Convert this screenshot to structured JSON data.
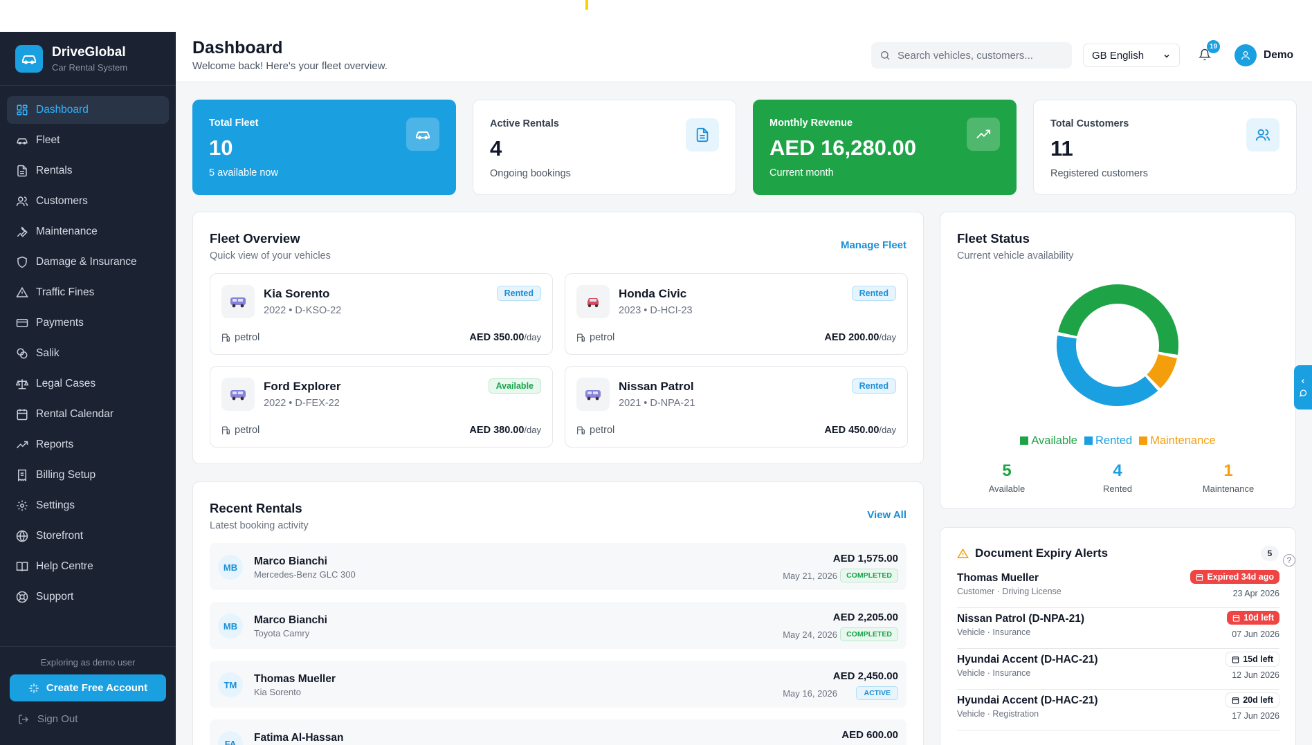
{
  "brand": {
    "name": "DriveGlobal",
    "subtitle": "Car Rental System"
  },
  "sidebar": {
    "items": [
      {
        "label": "Dashboard",
        "icon": "grid-icon",
        "active": true
      },
      {
        "label": "Fleet",
        "icon": "car-icon"
      },
      {
        "label": "Rentals",
        "icon": "document-icon"
      },
      {
        "label": "Customers",
        "icon": "users-icon"
      },
      {
        "label": "Maintenance",
        "icon": "wrench-icon"
      },
      {
        "label": "Damage & Insurance",
        "icon": "shield-icon"
      },
      {
        "label": "Traffic Fines",
        "icon": "warning-icon"
      },
      {
        "label": "Payments",
        "icon": "credit-card-icon"
      },
      {
        "label": "Salik",
        "icon": "coins-icon"
      },
      {
        "label": "Legal Cases",
        "icon": "scale-icon"
      },
      {
        "label": "Rental Calendar",
        "icon": "calendar-icon"
      },
      {
        "label": "Reports",
        "icon": "trend-icon"
      },
      {
        "label": "Billing Setup",
        "icon": "receipt-icon"
      },
      {
        "label": "Settings",
        "icon": "gear-icon"
      },
      {
        "label": "Storefront",
        "icon": "globe-icon"
      },
      {
        "label": "Help Centre",
        "icon": "book-icon"
      },
      {
        "label": "Support",
        "icon": "lifebuoy-icon"
      }
    ],
    "exploring": "Exploring as demo user",
    "cta": "Create Free Account",
    "signout": "Sign Out"
  },
  "header": {
    "title": "Dashboard",
    "subtitle": "Welcome back! Here's your fleet overview.",
    "search_placeholder": "Search vehicles, customers...",
    "language": "GB English",
    "notifications": "19",
    "user": "Demo"
  },
  "stats": [
    {
      "label": "Total Fleet",
      "value": "10",
      "note": "5 available now",
      "icon": "car-icon",
      "color": "#1a9fe0"
    },
    {
      "label": "Active Rentals",
      "value": "4",
      "note": "Ongoing bookings",
      "icon": "document-icon"
    },
    {
      "label": "Monthly Revenue",
      "value": "AED 16,280.00",
      "note": "Current month",
      "icon": "trend-up-icon",
      "color": "#1ea446"
    },
    {
      "label": "Total Customers",
      "value": "11",
      "note": "Registered customers",
      "icon": "users-icon"
    }
  ],
  "fleet_overview": {
    "title": "Fleet Overview",
    "subtitle": "Quick view of your vehicles",
    "link": "Manage Fleet",
    "vehicles": [
      {
        "name": "Kia Sorento",
        "meta": "2022 • D-KSO-22",
        "status": "Rented",
        "fuel": "petrol",
        "price": "AED 350.00",
        "per": "/day"
      },
      {
        "name": "Honda Civic",
        "meta": "2023 • D-HCI-23",
        "status": "Rented",
        "fuel": "petrol",
        "price": "AED 200.00",
        "per": "/day"
      },
      {
        "name": "Ford Explorer",
        "meta": "2022 • D-FEX-22",
        "status": "Available",
        "fuel": "petrol",
        "price": "AED 380.00",
        "per": "/day"
      },
      {
        "name": "Nissan Patrol",
        "meta": "2021 • D-NPA-21",
        "status": "Rented",
        "fuel": "petrol",
        "price": "AED 450.00",
        "per": "/day"
      }
    ]
  },
  "fleet_status": {
    "title": "Fleet Status",
    "subtitle": "Current vehicle availability",
    "counts": [
      {
        "label": "Available",
        "value": "5",
        "color": "#1ea446"
      },
      {
        "label": "Rented",
        "value": "4",
        "color": "#1a9fe0"
      },
      {
        "label": "Maintenance",
        "value": "1",
        "color": "#f59e0b"
      }
    ]
  },
  "chart_data": {
    "type": "pie",
    "categories": [
      "Available",
      "Rented",
      "Maintenance"
    ],
    "values": [
      5,
      4,
      1
    ],
    "colors": [
      "#1ea446",
      "#1a9fe0",
      "#f59e0b"
    ],
    "donut": true,
    "legend": "bottom"
  },
  "recent_rentals": {
    "title": "Recent Rentals",
    "subtitle": "Latest booking activity",
    "link": "View All",
    "rows": [
      {
        "initials": "MB",
        "name": "Marco Bianchi",
        "car": "Mercedes-Benz GLC 300",
        "amount": "AED 1,575.00",
        "date": "May 21, 2026",
        "status": "COMPLETED"
      },
      {
        "initials": "MB",
        "name": "Marco Bianchi",
        "car": "Toyota Camry",
        "amount": "AED 2,205.00",
        "date": "May 24, 2026",
        "status": "COMPLETED"
      },
      {
        "initials": "TM",
        "name": "Thomas Mueller",
        "car": "Kia Sorento",
        "amount": "AED 2,450.00",
        "date": "May 16, 2026",
        "status": "ACTIVE"
      },
      {
        "initials": "FA",
        "name": "Fatima Al-Hassan",
        "car": "",
        "amount": "AED 600.00",
        "date": "",
        "status": ""
      }
    ]
  },
  "doc_alerts": {
    "title": "Document Expiry Alerts",
    "count": "5",
    "rows": [
      {
        "name": "Thomas Mueller",
        "sub": "Customer · Driving License",
        "badge": "Expired 34d ago",
        "date": "23 Apr 2026",
        "severity": "red"
      },
      {
        "name": "Nissan Patrol (D-NPA-21)",
        "sub": "Vehicle · Insurance",
        "badge": "10d left",
        "date": "07 Jun 2026",
        "severity": "red"
      },
      {
        "name": "Hyundai Accent (D-HAC-21)",
        "sub": "Vehicle · Insurance",
        "badge": "15d left",
        "date": "12 Jun 2026",
        "severity": "normal"
      },
      {
        "name": "Hyundai Accent (D-HAC-21)",
        "sub": "Vehicle · Registration",
        "badge": "20d left",
        "date": "17 Jun 2026",
        "severity": "normal"
      }
    ]
  }
}
